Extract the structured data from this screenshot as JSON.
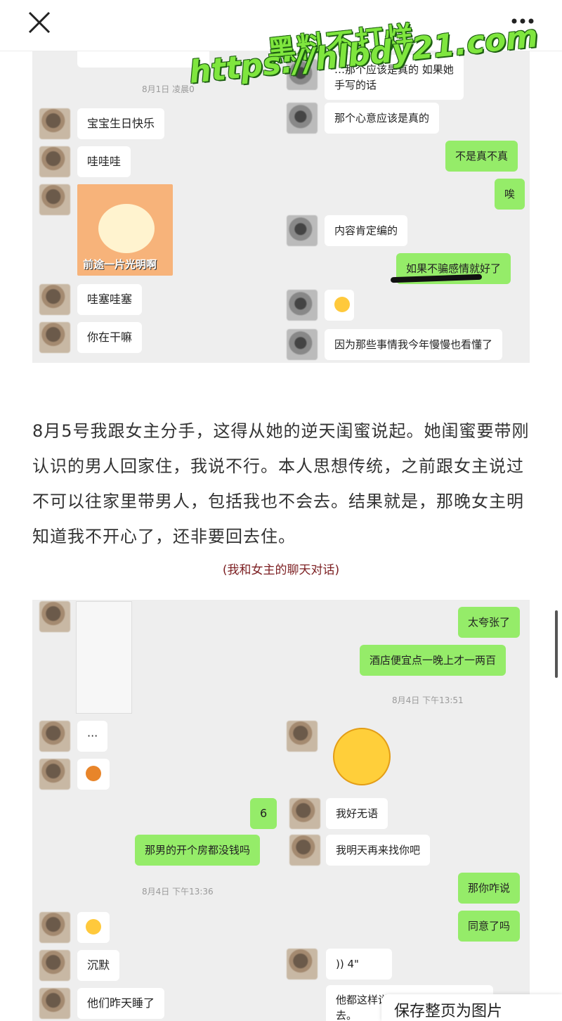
{
  "topbar": {
    "close_icon": "close-icon",
    "more_icon": "more-icon"
  },
  "watermark": {
    "line1": "黑料不打烊",
    "line2": "https://hlbdy21.com"
  },
  "chat1": {
    "timestamp": "8月1日 凌晨0",
    "left_messages": [
      "宝宝生日快乐",
      "哇哇哇",
      "哇塞哇塞",
      "你在干嘛"
    ],
    "sticker_text": "前途一片光明啊",
    "right_messages": [
      {
        "text": "…那个应该是真的 如果她\n手写的话",
        "side": "left"
      },
      {
        "text": "那个心意应该是真的",
        "side": "left"
      },
      {
        "text": "不是真不真",
        "side": "right"
      },
      {
        "text": "唉",
        "side": "right"
      },
      {
        "text": "内容肯定编的",
        "side": "left"
      },
      {
        "text": "如果不骗感情就好了",
        "side": "right"
      },
      {
        "text": "因为那些事情我今年慢慢也看懂了",
        "side": "left"
      }
    ]
  },
  "article": {
    "paragraph": "8月5号我跟女主分手，这得从她的逆天闺蜜说起。她闺蜜要带刚认识的男人回家住，我说不行。本人思想传统，之前跟女主说过不可以往家里带男人，包括我也不会去。结果就是，那晚女主明知道我不开心了，还非要回去住。",
    "caption": "(我和女主的聊天对话)"
  },
  "chat2": {
    "right": {
      "green1": "太夸张了",
      "green2": "酒店便宜点一晚上才一两百",
      "timestamp1": "8月4日 下午13:51",
      "num6": "6",
      "reply1": "我好无语",
      "green3": "那男的开个房都没钱吗",
      "reply2": "我明天再来找你吧",
      "green4": "那你咋说",
      "green5": "同意了吗",
      "voice": "4\"",
      "reply3": "他都这样说了，我就没有办法回\n去。"
    },
    "left": {
      "dots": "···",
      "timestamp2": "8月4日 下午13:36",
      "silence": "沉默",
      "slept": "他们昨天睡了"
    }
  },
  "bottom_fab": "保存整页为图片"
}
